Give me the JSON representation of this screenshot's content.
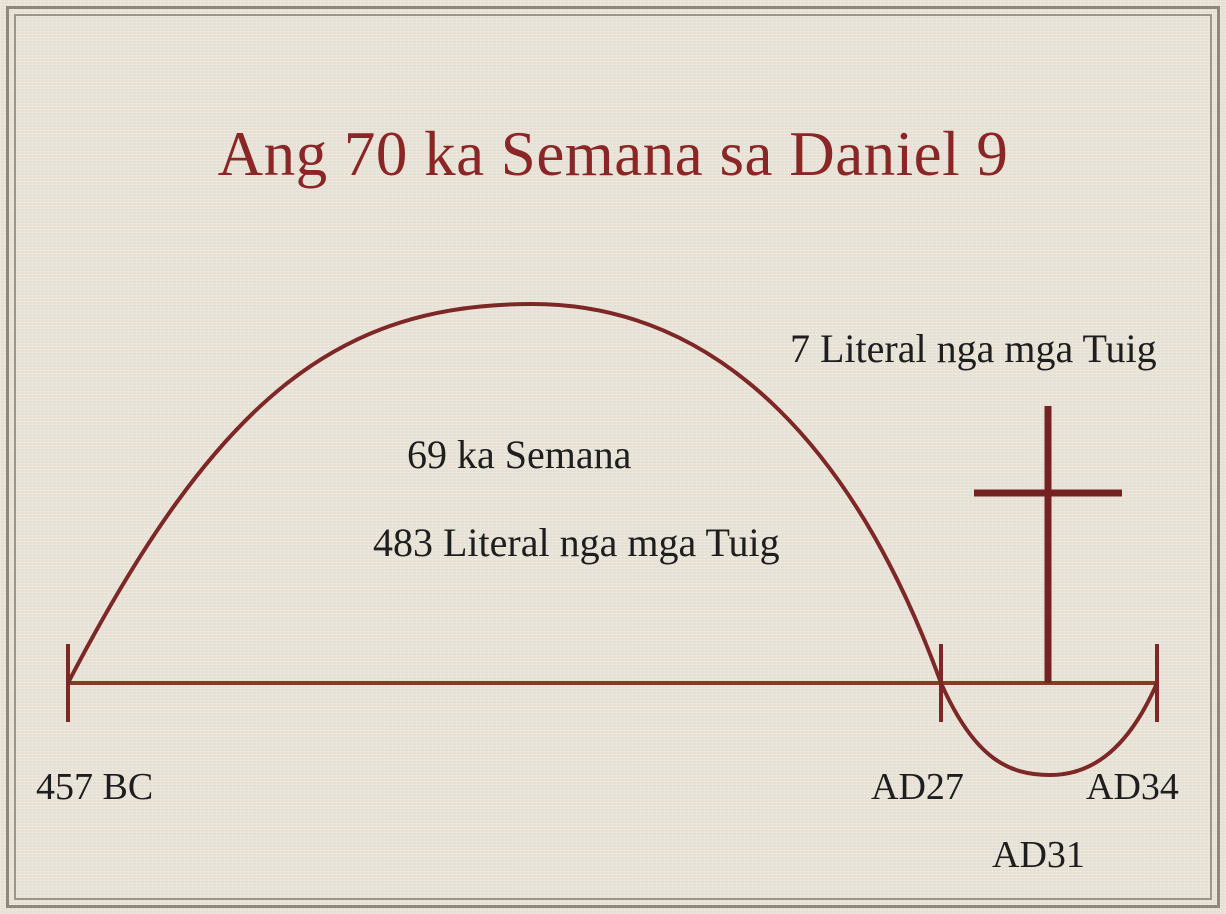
{
  "title": "Ang 70 ka Semana sa Daniel 9",
  "labels": {
    "weeks_69": "69 ka Semana",
    "years_483": "483 Literal nga mga Tuig",
    "years_7": "7 Literal nga mga Tuig",
    "start": "457 BC",
    "ad27": "AD27",
    "ad31": "AD31",
    "ad34": "AD34"
  },
  "colors": {
    "title": "#8a2626",
    "arc": "#7d2727",
    "timeline": "#8a3a22",
    "cross": "#772222",
    "background": "#ece6da"
  }
}
